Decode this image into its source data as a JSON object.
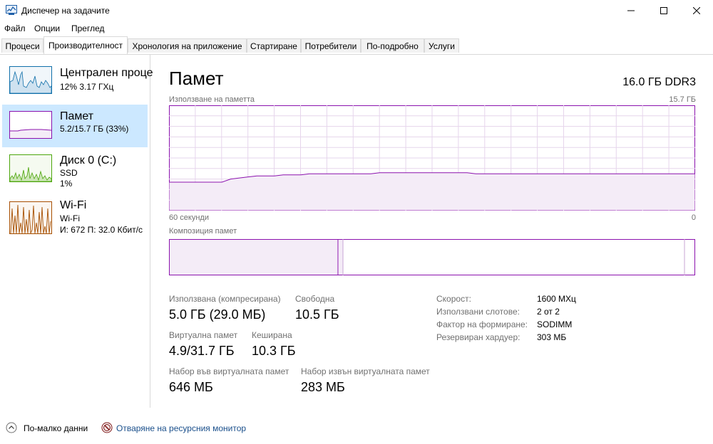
{
  "window": {
    "title": "Диспечер на задачите",
    "controls": {
      "minimize": "—",
      "maximize": "☐",
      "close": "✕"
    }
  },
  "menu": [
    "Файл",
    "Опции",
    "Преглед"
  ],
  "tabs": [
    {
      "label": "Процеси",
      "active": false
    },
    {
      "label": "Производителност",
      "active": true
    },
    {
      "label": "Хронология на приложение",
      "active": false
    },
    {
      "label": "Стартиране",
      "active": false
    },
    {
      "label": "Потребители",
      "active": false
    },
    {
      "label": "По-подробно",
      "active": false
    },
    {
      "label": "Услуги",
      "active": false
    }
  ],
  "sidebar": {
    "items": [
      {
        "title": "Централен проце",
        "sub1": "12%  3.17 ГХц",
        "sub2": "",
        "sub3": "",
        "color": "#1170aa"
      },
      {
        "title": "Памет",
        "sub1": "5.2/15.7 ГБ (33%)",
        "sub2": "",
        "sub3": "",
        "color": "#8b12ae"
      },
      {
        "title": "Диск 0 (C:)",
        "sub1": "SSD",
        "sub2": "1%",
        "sub3": "",
        "color": "#4da60c"
      },
      {
        "title": "Wi-Fi",
        "sub1": "Wi-Fi",
        "sub2": "И: 672  П: 32.0 Кбит/с",
        "sub3": "",
        "color": "#a74f01"
      }
    ]
  },
  "memory": {
    "title": "Памет",
    "total": "16.0 ГБ DDR3",
    "usage_label": "Използване на паметта",
    "usage_max": "15.7 ГБ",
    "time_left": "60 секунди",
    "time_right": "0",
    "composition_label": "Композиция памет",
    "accent": "#8b12ae",
    "stats": {
      "in_use_label": "Използвана (компресирана)",
      "in_use_value": "5.0 ГБ (29.0 МБ)",
      "available_label": "Свободна",
      "available_value": "10.5 ГБ",
      "committed_label": "Виртуална памет",
      "committed_value": "4.9/31.7 ГБ",
      "cached_label": "Кеширана",
      "cached_value": "10.3 ГБ",
      "paged_label": "Набор във виртуалната памет",
      "paged_value": "646 МБ",
      "nonpaged_label": "Набор извън виртуалната памет",
      "nonpaged_value": "283 МБ"
    },
    "specs": [
      {
        "label": "Скорост:",
        "value": "1600 МХц"
      },
      {
        "label": "Използвани слотове:",
        "value": "2 от 2"
      },
      {
        "label": "Фактор на формиране:",
        "value": "SODIMM"
      },
      {
        "label": "Резервиран хардуер:",
        "value": "303 МБ"
      }
    ],
    "usage_history_fraction": [
      0.27,
      0.27,
      0.27,
      0.27,
      0.27,
      0.27,
      0.27,
      0.3,
      0.31,
      0.32,
      0.33,
      0.33,
      0.33,
      0.34,
      0.34,
      0.34,
      0.35,
      0.35,
      0.35,
      0.35,
      0.35,
      0.35,
      0.35,
      0.35,
      0.36,
      0.36,
      0.36,
      0.36,
      0.36,
      0.36,
      0.36,
      0.36,
      0.36,
      0.36,
      0.36,
      0.35,
      0.35,
      0.35,
      0.35,
      0.35,
      0.35,
      0.35,
      0.35,
      0.35,
      0.35,
      0.35,
      0.35,
      0.35,
      0.35,
      0.35,
      0.35,
      0.35,
      0.35,
      0.35,
      0.35,
      0.35,
      0.35,
      0.35,
      0.35,
      0.35,
      0.35
    ]
  },
  "footer": {
    "fewer_details": "По-малко данни",
    "open_monitor": "Отваряне на ресурсния монитор"
  }
}
